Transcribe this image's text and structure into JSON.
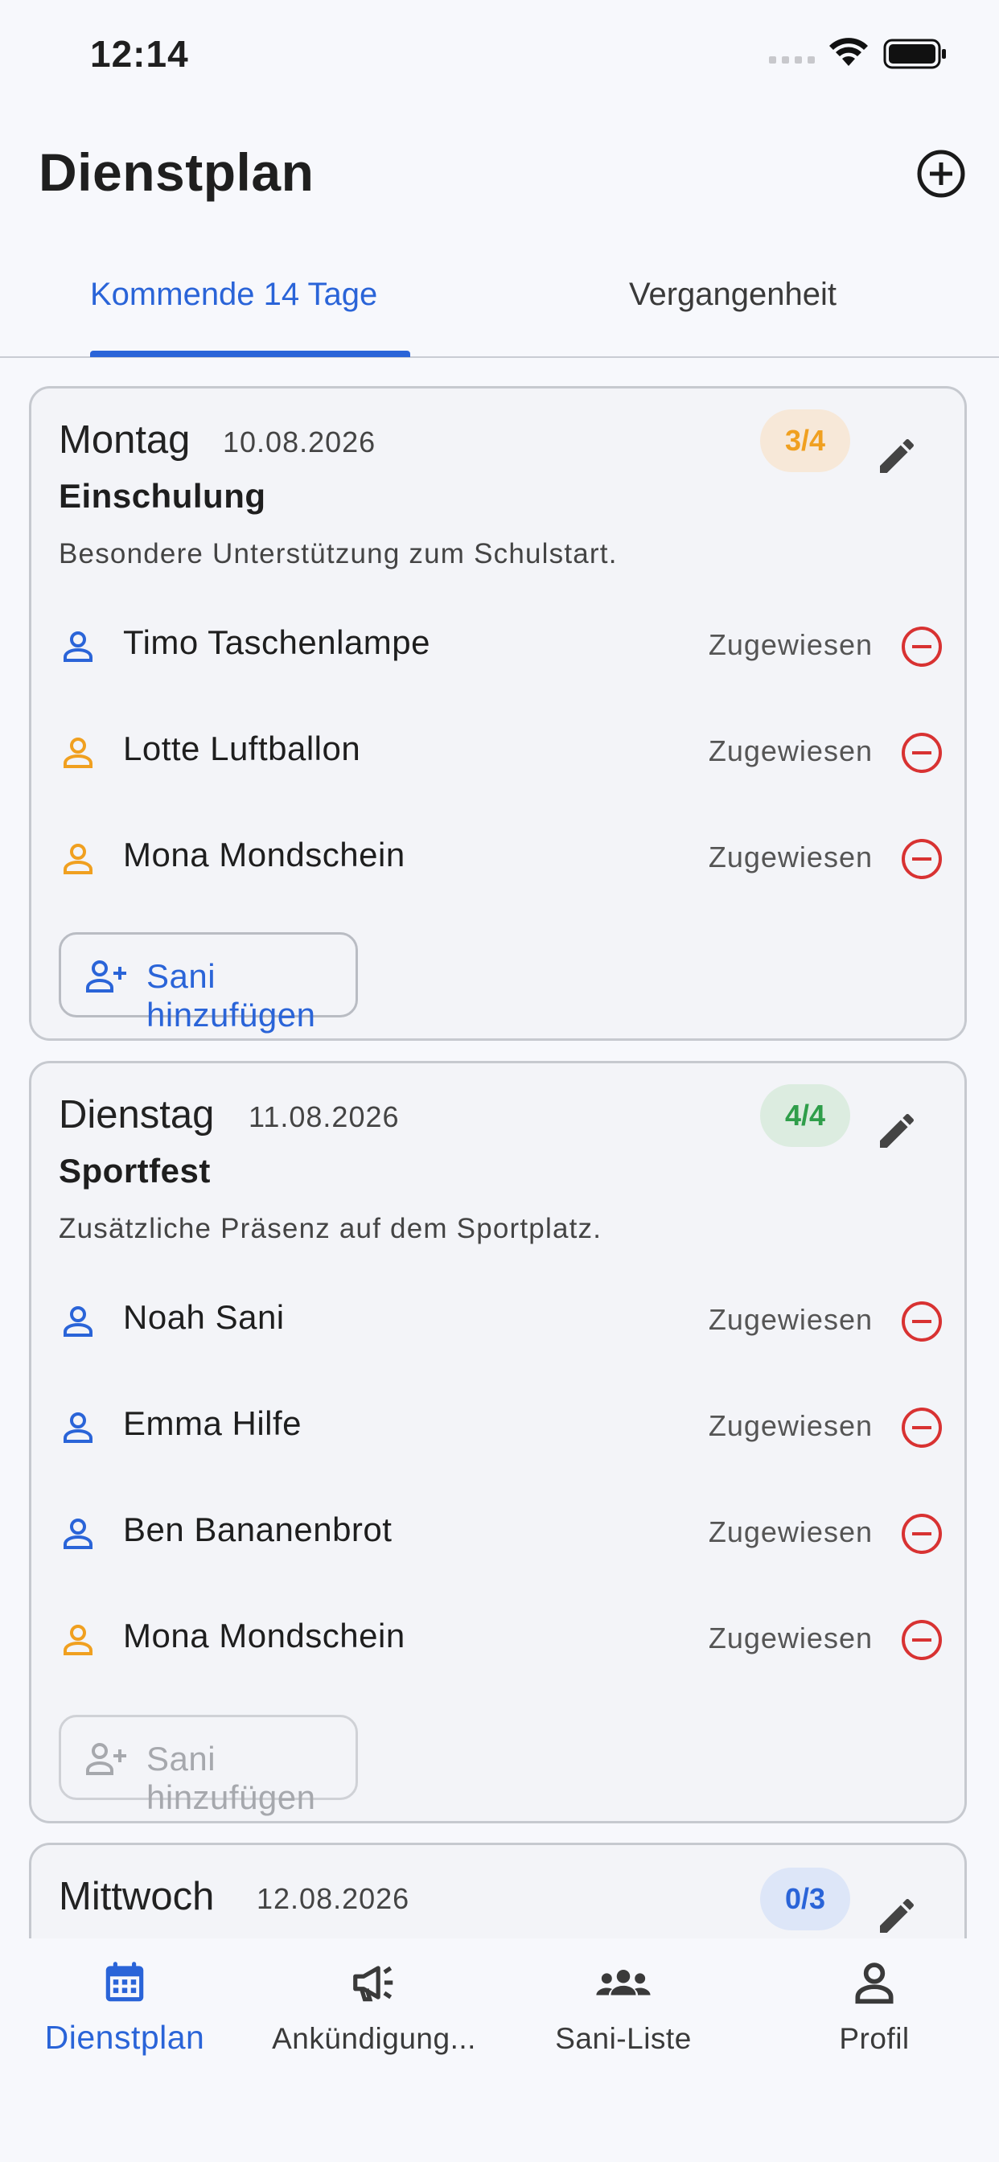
{
  "status_bar": {
    "time": "12:14"
  },
  "header": {
    "title": "Dienstplan"
  },
  "tabs": [
    {
      "label": "Kommende 14 Tage",
      "active": true
    },
    {
      "label": "Vergangenheit",
      "active": false
    }
  ],
  "colors": {
    "accent": "#2a64d8",
    "badge_partial": "#f0a020",
    "badge_full": "#2f9e4a",
    "badge_empty": "#2a64d8",
    "remove": "#d83232",
    "person_blue": "#2a64d8",
    "person_orange": "#f0a020"
  },
  "cards": [
    {
      "day": "Montag",
      "date": "10.08.2026",
      "event": "Einschulung",
      "description": "Besondere Unterstützung zum Schulstart.",
      "badge": "3/4",
      "assignees": [
        {
          "name": "Timo Taschenlampe",
          "status": "Zugewiesen",
          "icon_color": "blue"
        },
        {
          "name": "Lotte Luftballon",
          "status": "Zugewiesen",
          "icon_color": "orange"
        },
        {
          "name": "Mona Mondschein",
          "status": "Zugewiesen",
          "icon_color": "orange"
        }
      ],
      "add_button": "Sani hinzufügen"
    },
    {
      "day": "Dienstag",
      "date": "11.08.2026",
      "event": "Sportfest",
      "description": "Zusätzliche Präsenz auf dem Sportplatz.",
      "badge": "4/4",
      "assignees": [
        {
          "name": "Noah Sani",
          "status": "Zugewiesen",
          "icon_color": "blue"
        },
        {
          "name": "Emma Hilfe",
          "status": "Zugewiesen",
          "icon_color": "blue"
        },
        {
          "name": "Ben Bananenbrot",
          "status": "Zugewiesen",
          "icon_color": "blue"
        },
        {
          "name": "Mona Mondschein",
          "status": "Zugewiesen",
          "icon_color": "orange"
        }
      ],
      "add_button": "Sani hinzufügen"
    },
    {
      "day": "Mittwoch",
      "date": "12.08.2026",
      "badge": "0/3"
    }
  ],
  "nav": [
    {
      "label": "Dienstplan",
      "icon": "calendar-icon",
      "active": true
    },
    {
      "label": "Ankündigung...",
      "icon": "megaphone-icon",
      "active": false
    },
    {
      "label": "Sani-Liste",
      "icon": "group-icon",
      "active": false
    },
    {
      "label": "Profil",
      "icon": "person-icon",
      "active": false
    }
  ]
}
